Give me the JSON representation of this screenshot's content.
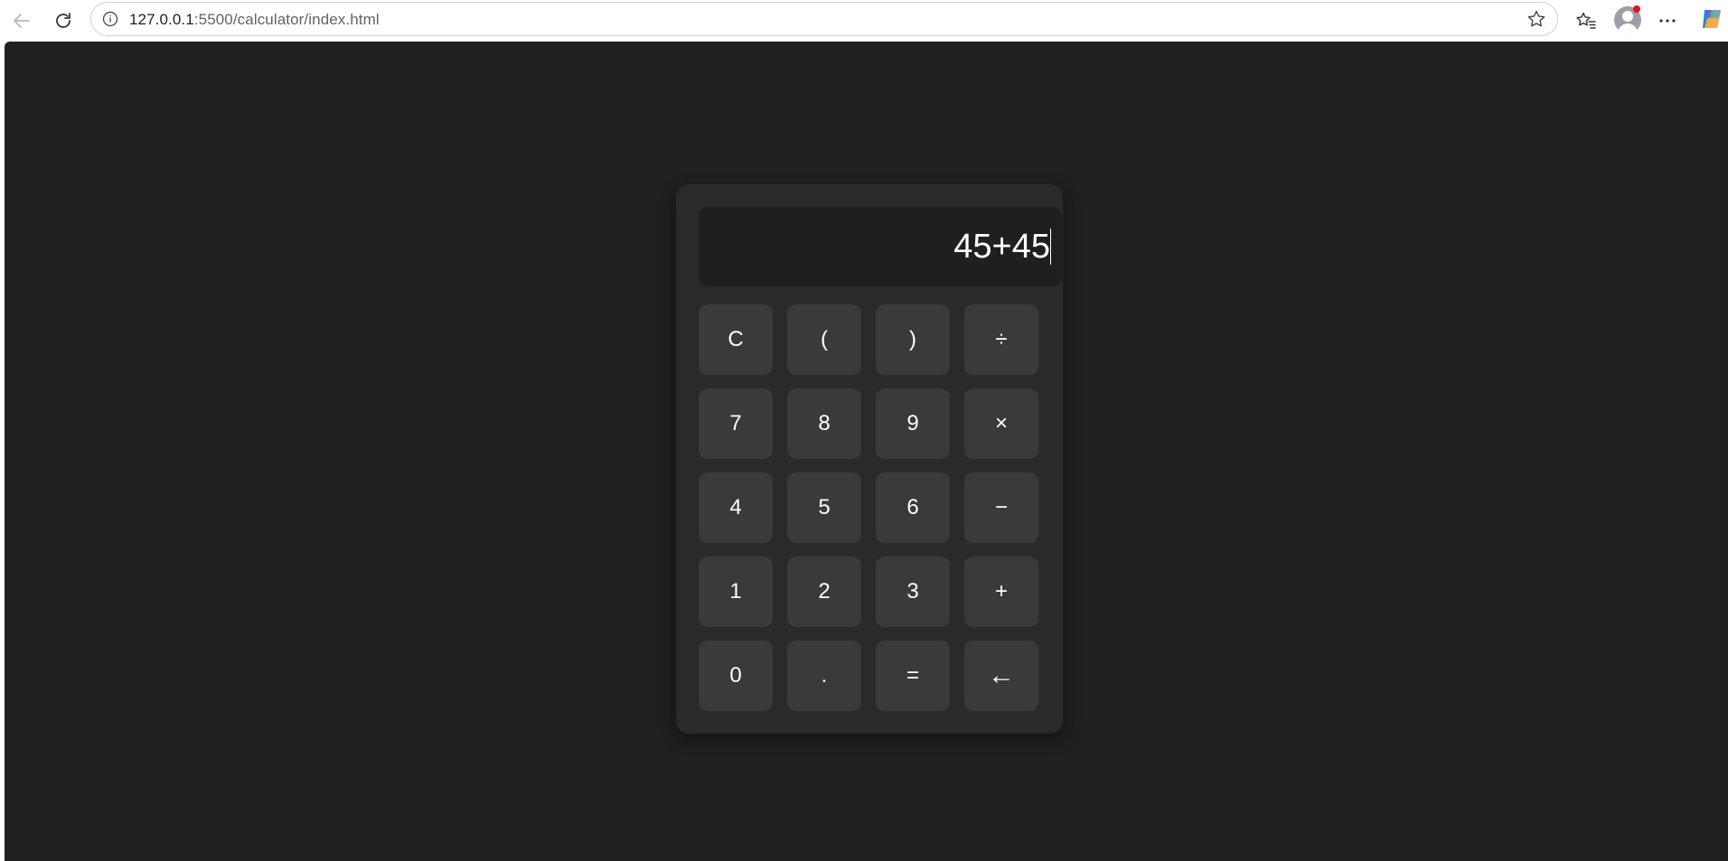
{
  "browser": {
    "url_host": "127.0.0.1",
    "url_rest": ":5500/calculator/index.html",
    "icons": {
      "back": "back-arrow-icon",
      "reload": "reload-icon",
      "site_info": "info-icon",
      "favorite": "star-icon",
      "favorites": "favorites-icon",
      "profile": "profile-icon",
      "more": "more-icon",
      "copilot": "copilot-icon"
    }
  },
  "calculator": {
    "display": "45+45",
    "keys": [
      [
        "C",
        "(",
        ")",
        "÷"
      ],
      [
        "7",
        "8",
        "9",
        "×"
      ],
      [
        "4",
        "5",
        "6",
        "−"
      ],
      [
        "1",
        "2",
        "3",
        "+"
      ],
      [
        "0",
        ".",
        "=",
        "←"
      ]
    ]
  },
  "colors": {
    "page_background": "#202020",
    "calculator_background": "#2a2a2a",
    "display_background": "#1f1f1f",
    "key_background": "#3a3a3a",
    "text": "#ffffff"
  }
}
